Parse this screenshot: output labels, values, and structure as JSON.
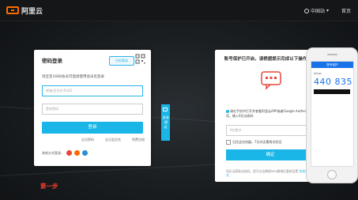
{
  "header": {
    "logo_text": "阿里云",
    "region_label": "中国站",
    "home_link": "首页",
    "brand_color": "#ff6a00"
  },
  "login": {
    "title": "密码登录",
    "qr_tag": "扫码登录",
    "subtitle": "淘宝及1688会员可直接使用会员名登录",
    "username_placeholder": "邮箱/会员名/8位ID",
    "password_placeholder": "登录密码",
    "submit_label": "登录",
    "links": [
      "忘记密码",
      "忘记会员名",
      "免费注册"
    ],
    "other_methods_label": "其他方式登录：",
    "step_caption": "第一步",
    "accent_color": "#1ab6e8"
  },
  "side_tab": {
    "label": "咨询·建议"
  },
  "verify": {
    "title": "账号保护已开启，请根据提示完成以下操作",
    "instruction": "请在手机中打开并查看阿里云APP或者Google Authenticator应用，输入6位动态码",
    "code_placeholder": "6位数字",
    "remember_label": "记住这台机器，7天内无需再次验证",
    "confirm_label": "确定",
    "footer_text": "如无法获取动态码，您可点击解绑MFA解绑后重新设置",
    "footer_link": "其他验证方式"
  },
  "phone": {
    "app_title": "账号保护",
    "account_label": "Alison",
    "code": "440 835"
  }
}
